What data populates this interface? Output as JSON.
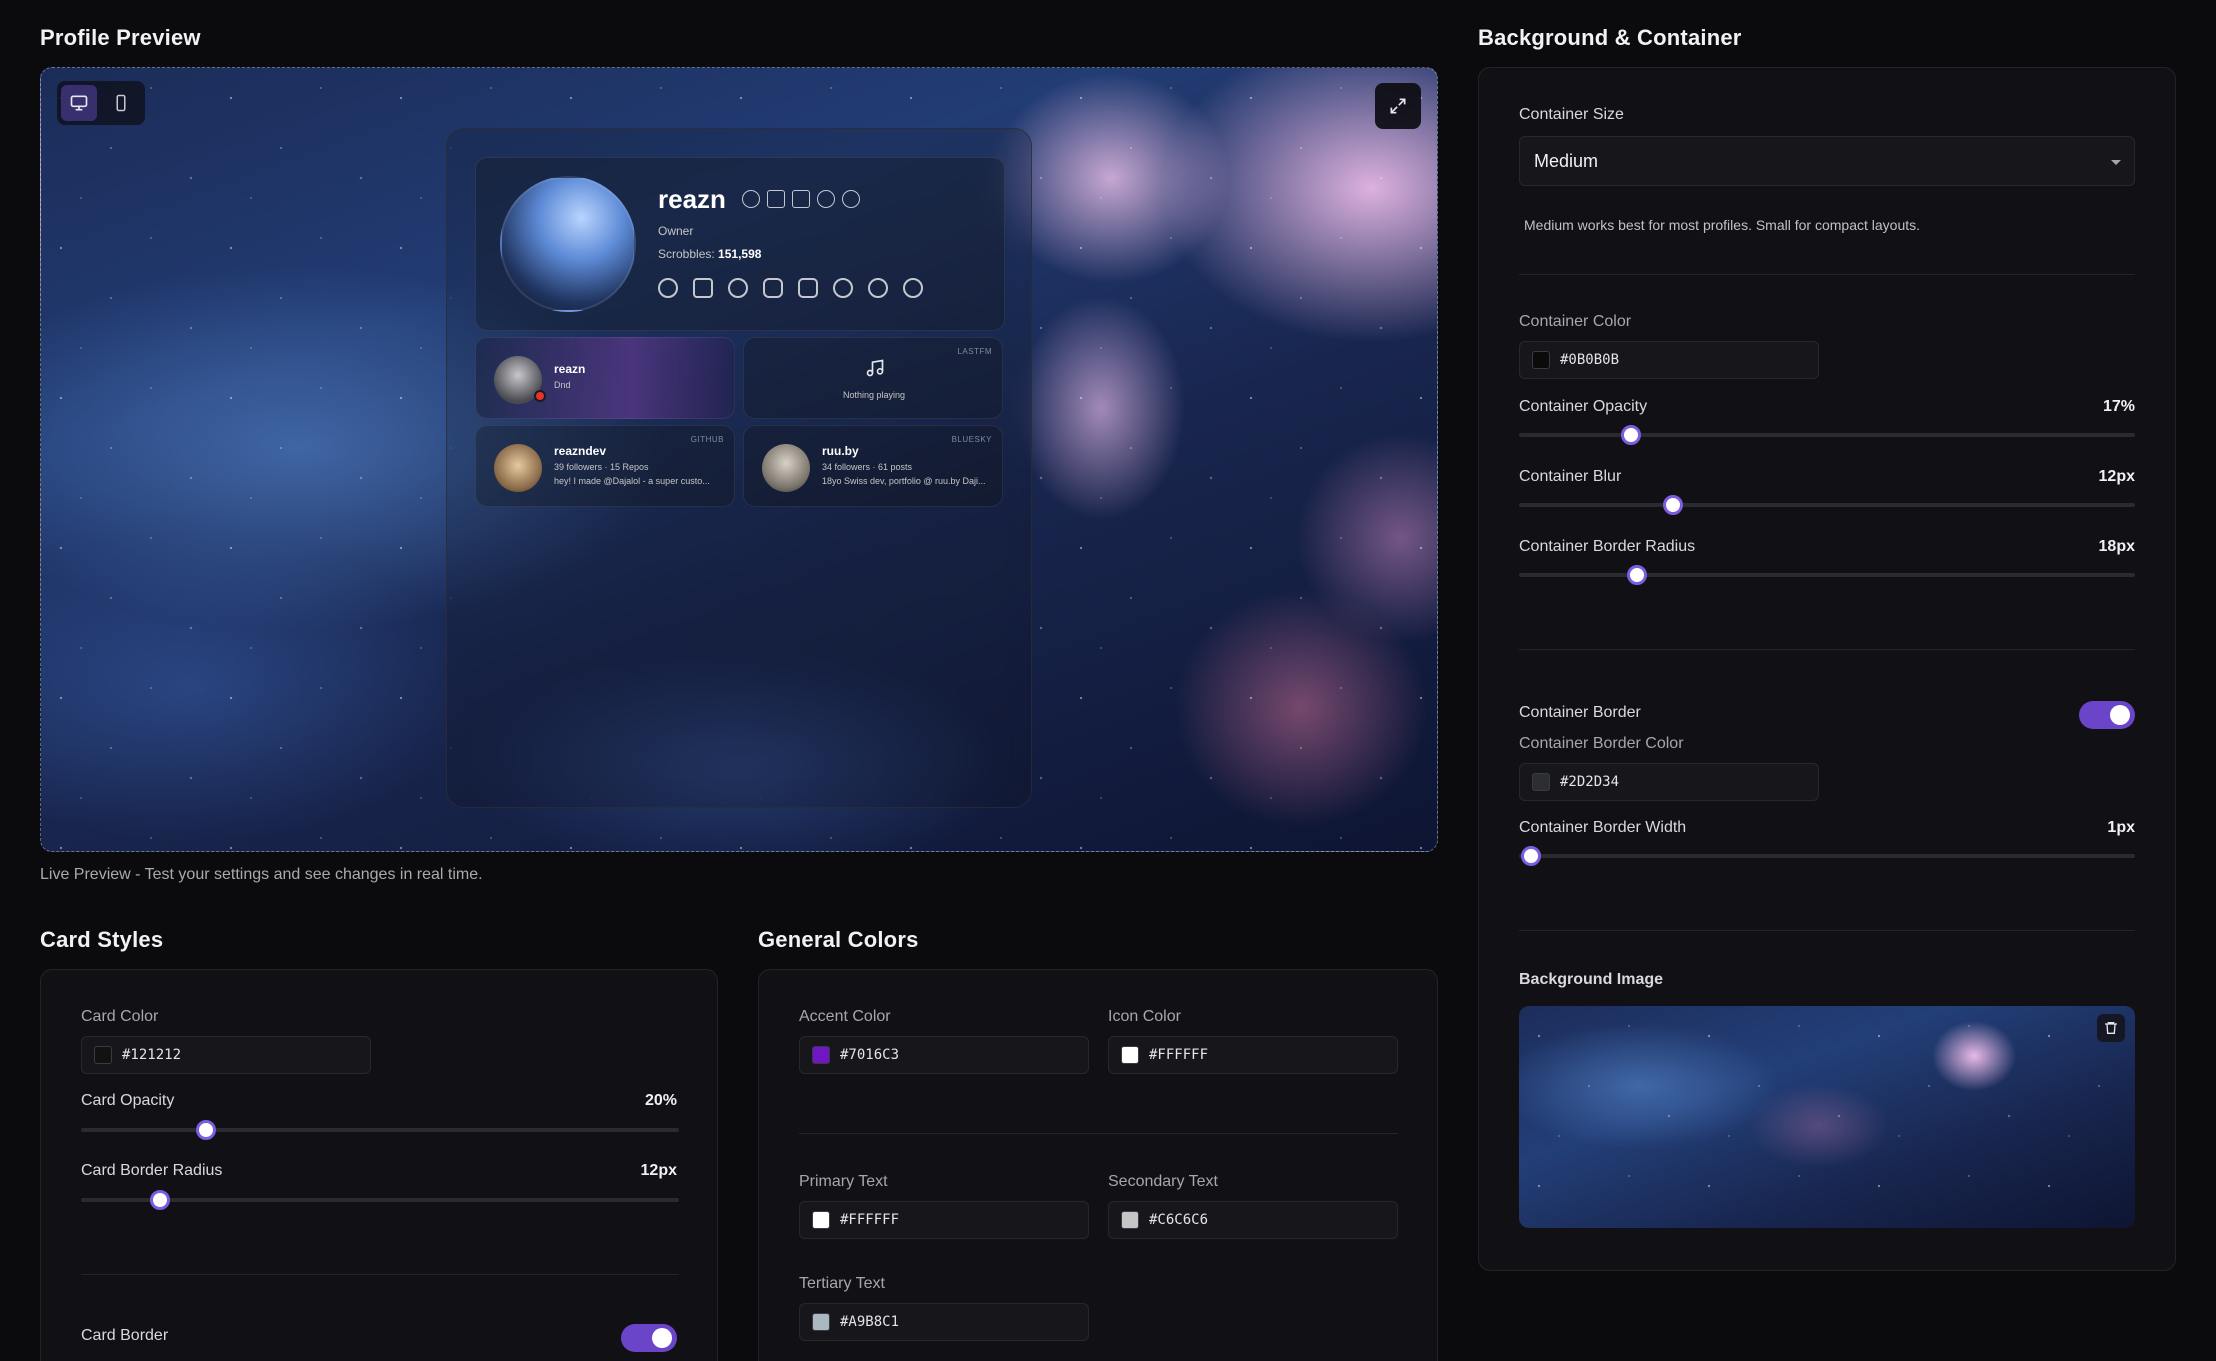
{
  "preview": {
    "title": "Profile Preview",
    "caption": "Live Preview - Test your settings and see changes in real time.",
    "device_modes": [
      "desktop",
      "mobile"
    ],
    "active_device": "desktop",
    "profile": {
      "username": "reazn",
      "role": "Owner",
      "scrobbles_label": "Scrobbles:",
      "scrobbles_value": "151,598",
      "badge_icons": [
        "verified-icon",
        "mail-icon",
        "calendar-icon",
        "users-icon",
        "user-icon"
      ],
      "social_icons": [
        "steam-icon",
        "bluesky-icon",
        "github-icon",
        "discord-icon",
        "lastfm-icon",
        "spotify-icon",
        "reddit-icon",
        "globe-icon"
      ]
    },
    "discord_card": {
      "name": "reazn",
      "status": "Dnd"
    },
    "lastfm_card": {
      "tag": "LASTFM",
      "text": "Nothing playing"
    },
    "github_card": {
      "tag": "GITHUB",
      "name": "reazndev",
      "stats": "39 followers · 15 Repos",
      "bio": "hey! I made @Dajalol - a super custo..."
    },
    "bluesky_card": {
      "tag": "BLUESKY",
      "name": "ruu.by",
      "stats": "34 followers · 61 posts",
      "bio": "18yo Swiss dev, portfolio @ ruu.by Daji..."
    }
  },
  "background_container": {
    "title": "Background & Container",
    "container_size_label": "Container Size",
    "container_size_value": "Medium",
    "container_size_hint": "Medium works best for most profiles. Small for compact layouts.",
    "container_color_label": "Container Color",
    "container_color_value": "#0B0B0B",
    "container_opacity_label": "Container Opacity",
    "container_opacity_value": "17%",
    "container_opacity_level": 0.17,
    "container_blur_label": "Container Blur",
    "container_blur_value": "12px",
    "container_radius_label": "Container Border Radius",
    "container_radius_value": "18px",
    "container_border_label": "Container Border",
    "container_border_enabled": true,
    "container_border_color_label": "Container Border Color",
    "container_border_color_value": "#2D2D34",
    "container_border_width_label": "Container Border Width",
    "container_border_width_value": "1px",
    "background_image_label": "Background Image"
  },
  "card_styles": {
    "title": "Card Styles",
    "card_color_label": "Card Color",
    "card_color_value": "#121212",
    "card_opacity_label": "Card Opacity",
    "card_opacity_value": "20%",
    "card_opacity_level": 0.2,
    "card_radius_label": "Card Border Radius",
    "card_radius_value": "12px",
    "card_border_label": "Card Border",
    "card_border_enabled": true
  },
  "general_colors": {
    "title": "General Colors",
    "accent_label": "Accent Color",
    "accent_value": "#7016C3",
    "icon_label": "Icon Color",
    "icon_value": "#FFFFFF",
    "primary_label": "Primary Text",
    "primary_value": "#FFFFFF",
    "secondary_label": "Secondary Text",
    "secondary_value": "#C6C6C6",
    "tertiary_label": "Tertiary Text",
    "tertiary_value": "#A9B8C1"
  }
}
